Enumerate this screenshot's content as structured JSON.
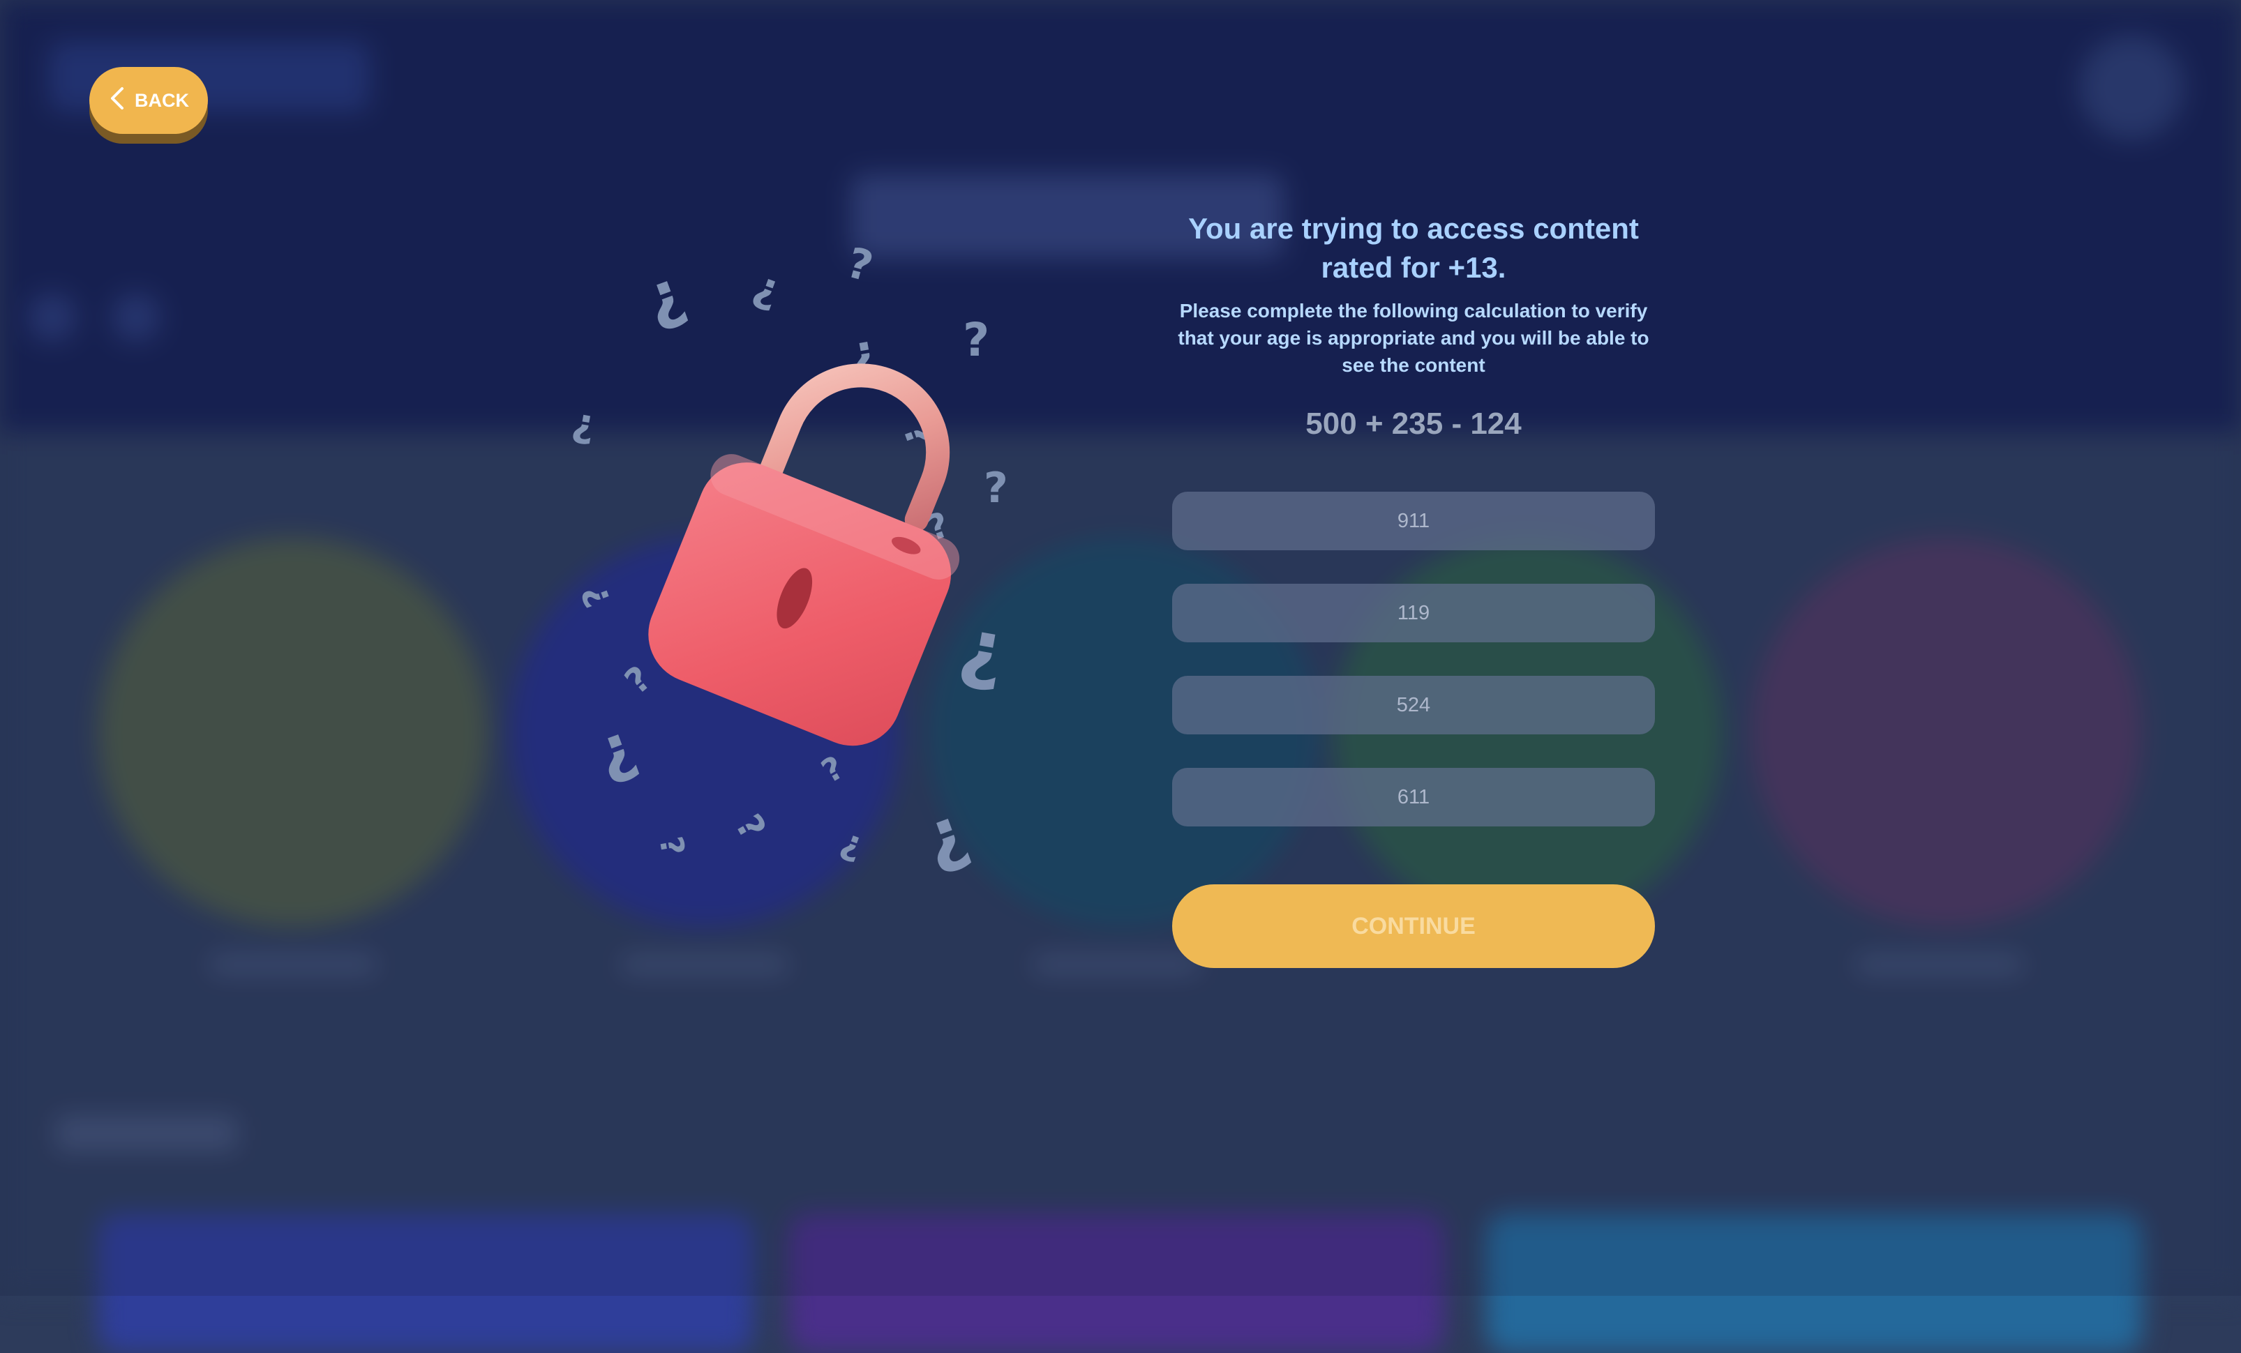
{
  "header": {
    "back_label": "BACK"
  },
  "age_gate": {
    "title": "You are trying to access content rated for +13.",
    "subtitle": "Please complete the following calculation to verify that your age is appropriate and you will be able to see the content",
    "calculation": "500 + 235 - 124",
    "options": [
      "911",
      "119",
      "524",
      "611"
    ],
    "continue_label": "CONTINUE"
  },
  "colors": {
    "accent": "#f1b64e",
    "title": "#a9d1ff",
    "lock_body": "#ee5c69",
    "background_dark": "#172255"
  },
  "icons": {
    "back": "chevron-left-icon",
    "illustration": "padlock-icon",
    "decoration": "question-mark-icon"
  }
}
